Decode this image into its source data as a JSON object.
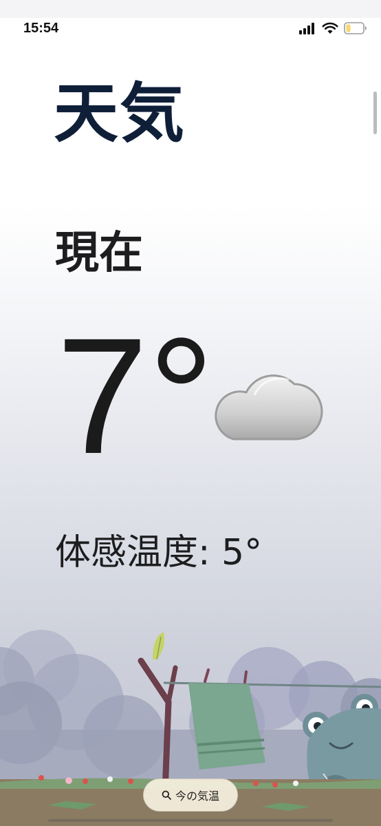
{
  "status_bar": {
    "time": "15:54",
    "signal_icon": "signal-bars-icon",
    "wifi_icon": "wifi-icon",
    "battery_icon": "battery-low-icon",
    "battery_color": "#f5d76e"
  },
  "weather": {
    "title": "天気",
    "current_label": "現在",
    "temperature": "7°",
    "condition_icon": "cloud-icon",
    "feels_like": "体感温度: 5°"
  },
  "search_button": {
    "icon": "search-icon",
    "label": "今の気温"
  },
  "colors": {
    "title": "#0f1f38",
    "text": "#1d1d1f"
  }
}
